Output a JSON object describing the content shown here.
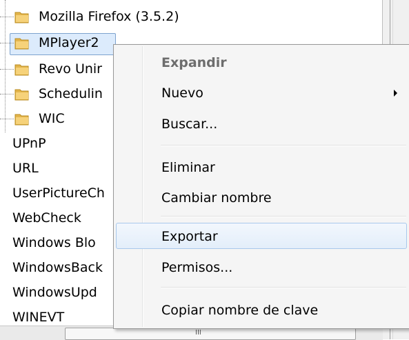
{
  "tree": {
    "folders": [
      {
        "label": "Mozilla Firefox (3.5.2)",
        "icon": "folder-icon"
      },
      {
        "label": "MPlayer2",
        "icon": "folder-icon"
      },
      {
        "label": "Revo Unir",
        "icon": "folder-icon"
      },
      {
        "label": "Schedulin",
        "icon": "folder-icon"
      },
      {
        "label": "WIC",
        "icon": "folder-icon"
      }
    ],
    "keys": [
      "UPnP",
      "URL",
      "UserPictureCh",
      "WebCheck",
      "Windows Blo",
      "WindowsBack",
      "WindowsUpd",
      "WINEVT"
    ]
  },
  "scrollbar": {
    "grip": "III"
  },
  "menu": {
    "items": [
      {
        "label": "Expandir",
        "state": "disabled"
      },
      {
        "label": "Nuevo",
        "submenu": true
      },
      {
        "label": "Buscar..."
      },
      {
        "label": "Eliminar"
      },
      {
        "label": "Cambiar nombre"
      },
      {
        "label": "Exportar",
        "state": "hover"
      },
      {
        "label": "Permisos..."
      },
      {
        "label": "Copiar nombre de clave"
      }
    ]
  },
  "colors": {
    "selection": "#dcebfc",
    "selection_border": "#7da2ce",
    "menu_bg": "#f5f5f5",
    "hover_border": "#a8c8ec"
  }
}
